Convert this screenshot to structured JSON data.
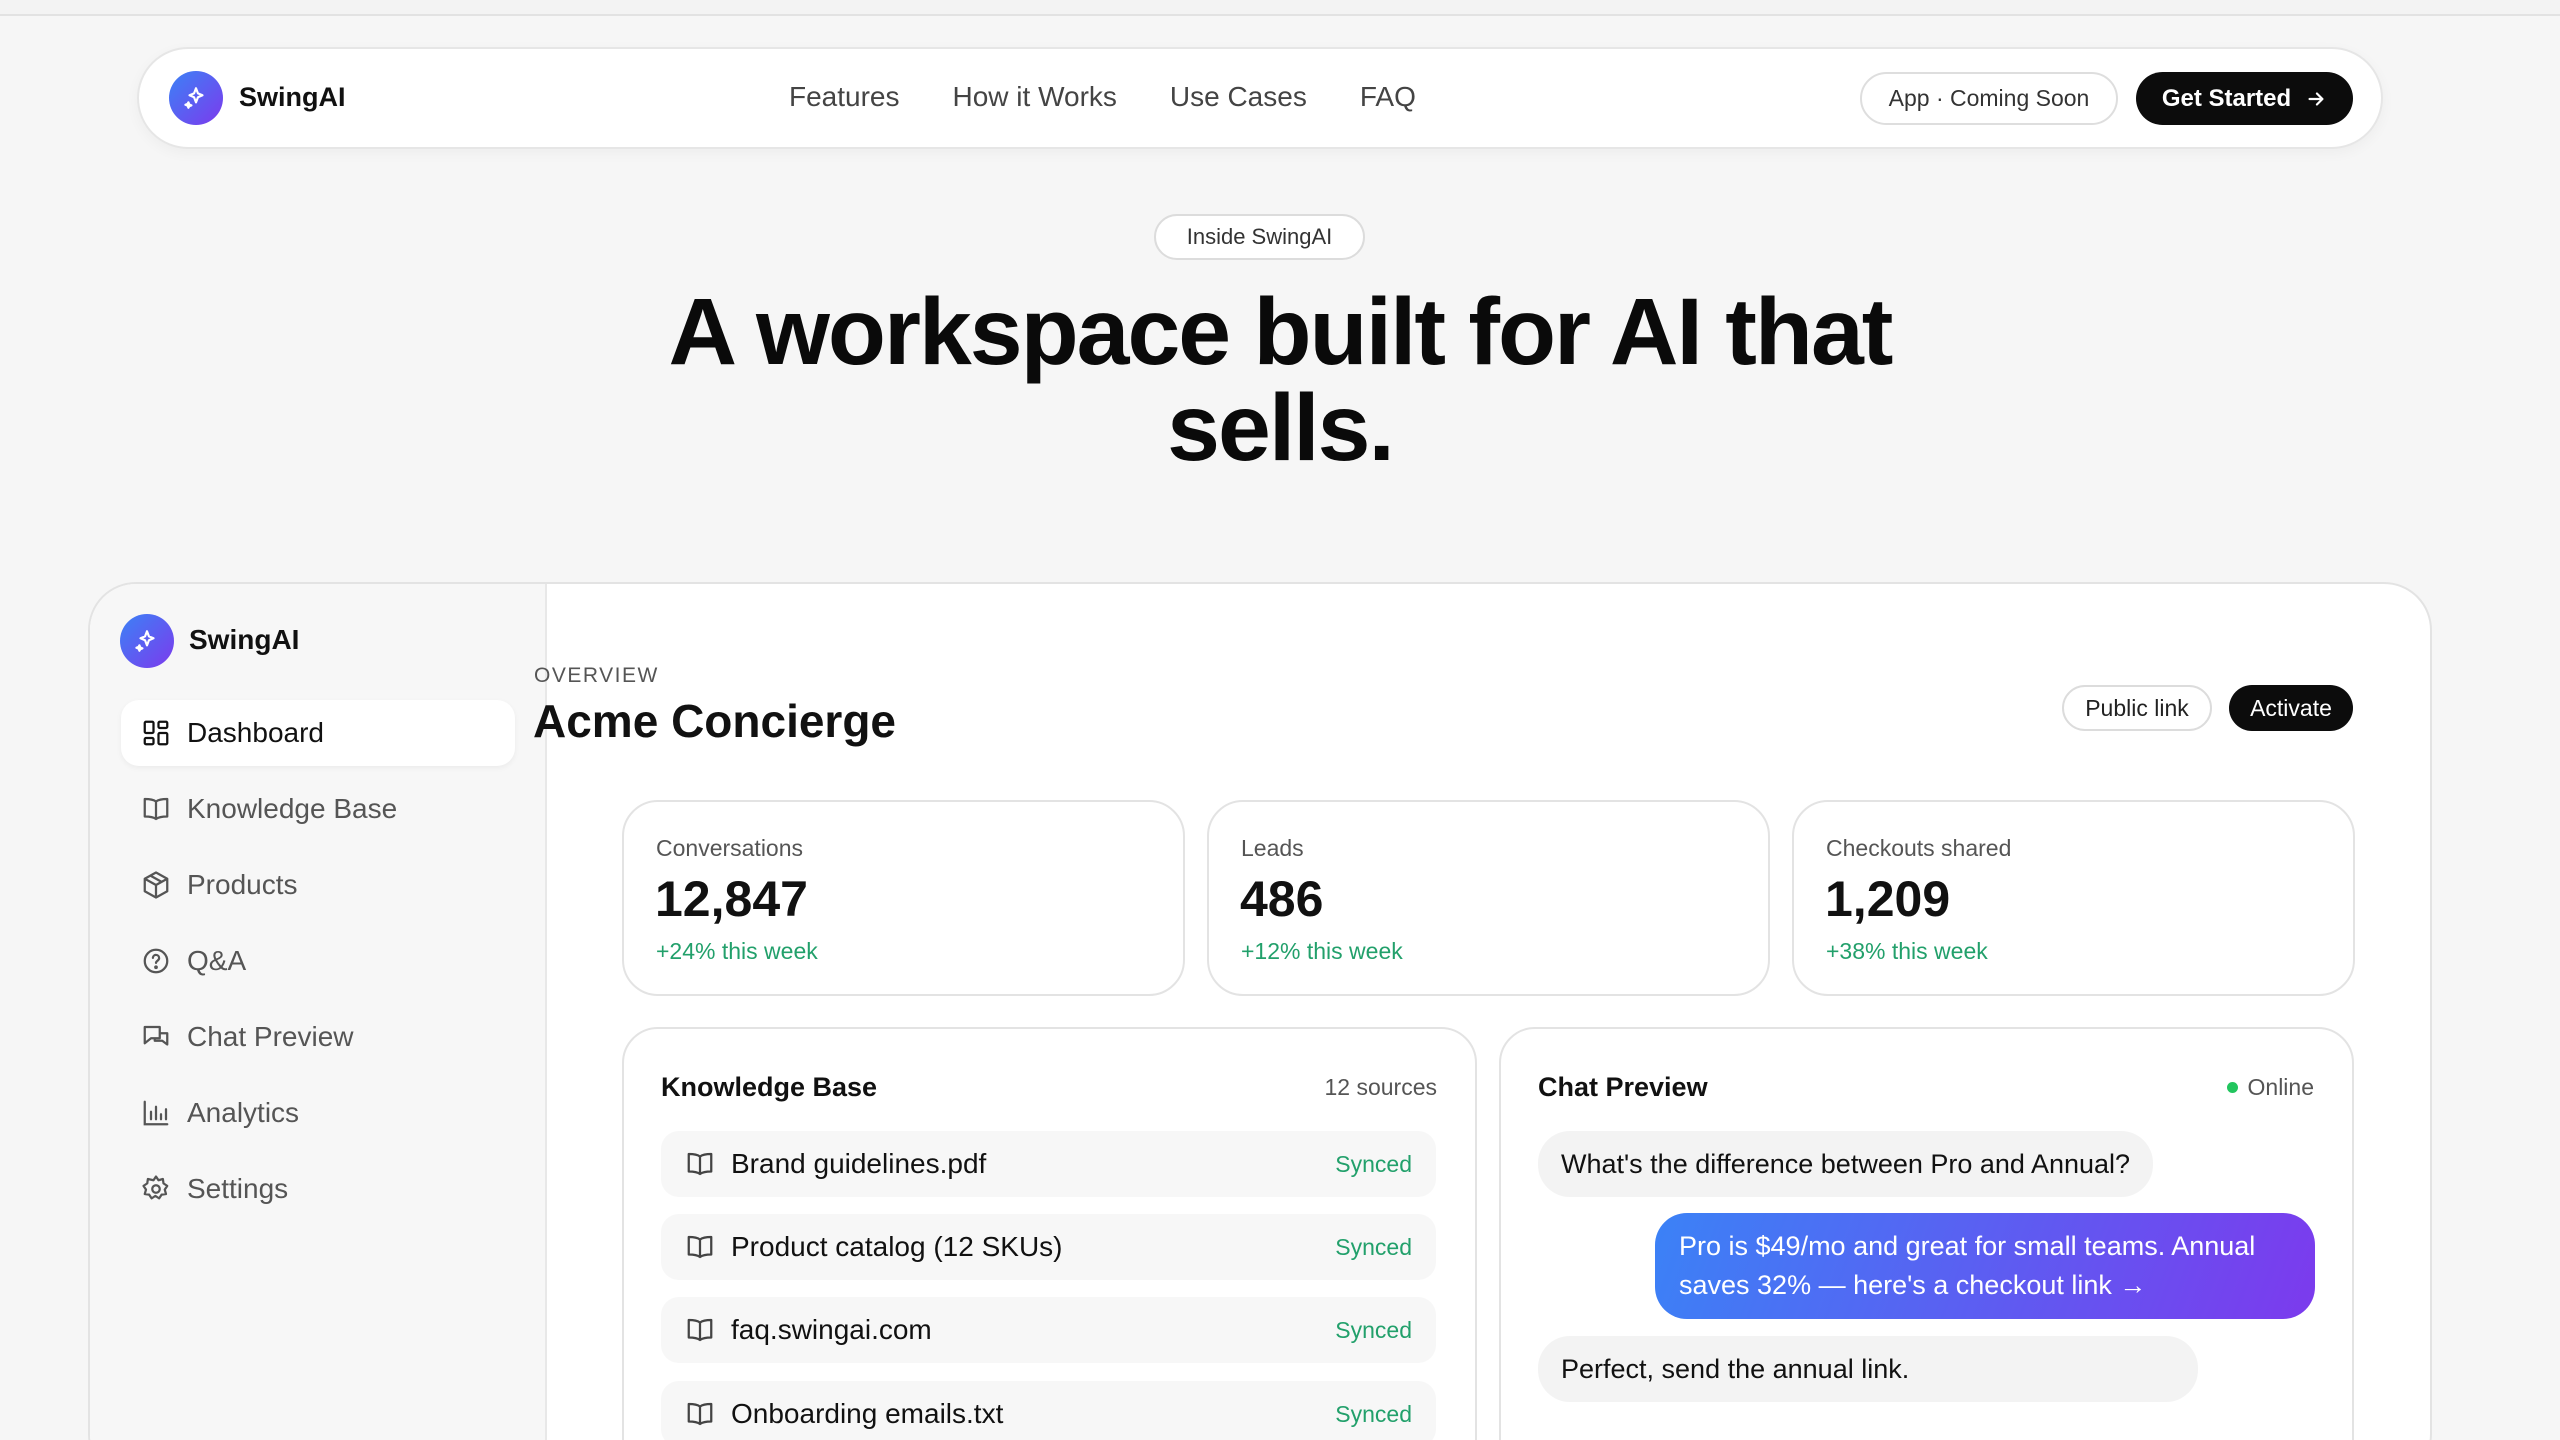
{
  "nav": {
    "brand": "SwingAI",
    "links": [
      "Features",
      "How it Works",
      "Use Cases",
      "FAQ"
    ],
    "app_pill": "App · Coming Soon",
    "cta": "Get Started"
  },
  "hero": {
    "eyebrow": "Inside SwingAI",
    "title": "A workspace built for AI that sells."
  },
  "sidebar": {
    "brand": "SwingAI",
    "items": [
      {
        "label": "Dashboard",
        "icon": "grid-icon",
        "active": true
      },
      {
        "label": "Knowledge Base",
        "icon": "book-icon"
      },
      {
        "label": "Products",
        "icon": "box-icon"
      },
      {
        "label": "Q&A",
        "icon": "question-icon"
      },
      {
        "label": "Chat Preview",
        "icon": "chat-icon"
      },
      {
        "label": "Analytics",
        "icon": "bar-chart-icon"
      },
      {
        "label": "Settings",
        "icon": "gear-icon"
      }
    ]
  },
  "main": {
    "overline": "OVERVIEW",
    "title": "Acme Concierge",
    "public_link": "Public link",
    "activate": "Activate",
    "stats": [
      {
        "label": "Conversations",
        "value": "12,847",
        "delta": "+24% this week"
      },
      {
        "label": "Leads",
        "value": "486",
        "delta": "+12% this week"
      },
      {
        "label": "Checkouts shared",
        "value": "1,209",
        "delta": "+38% this week"
      }
    ]
  },
  "knowledge_base": {
    "title": "Knowledge Base",
    "meta": "12 sources",
    "rows": [
      {
        "name": "Brand guidelines.pdf",
        "status": "Synced"
      },
      {
        "name": "Product catalog (12 SKUs)",
        "status": "Synced"
      },
      {
        "name": "faq.swingai.com",
        "status": "Synced"
      },
      {
        "name": "Onboarding emails.txt",
        "status": "Synced"
      }
    ]
  },
  "chat_preview": {
    "title": "Chat Preview",
    "status": "Online",
    "messages": [
      {
        "from": "user",
        "text": "What's the difference between Pro and Annual?"
      },
      {
        "from": "bot",
        "text": "Pro is $49/mo and great for small teams. Annual saves 32% — here's a checkout link →"
      },
      {
        "from": "user",
        "text": "Perfect, send the annual link."
      }
    ]
  },
  "colors": {
    "accent_start": "#3b82f6",
    "accent_end": "#7c3aed",
    "positive": "#22a06b",
    "dark": "#0c0c0c"
  }
}
